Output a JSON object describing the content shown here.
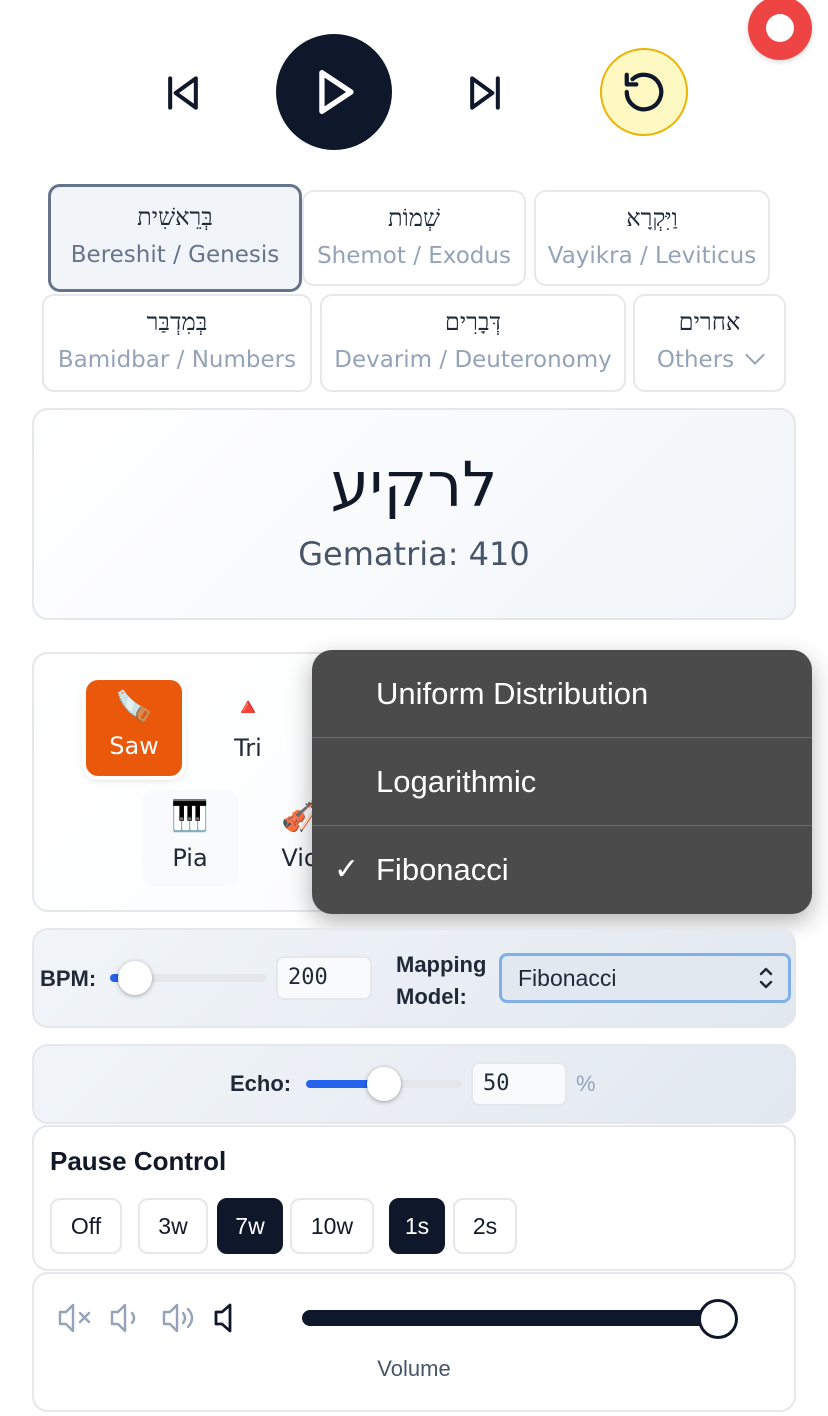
{
  "transport": {
    "record_icon": "record-icon",
    "prev_icon": "skip-back-icon",
    "play_icon": "play-icon",
    "next_icon": "skip-forward-icon",
    "reset_icon": "rotate-ccw-icon"
  },
  "books": [
    {
      "hebrew": "בְּרֵאשִׁית",
      "english": "Bereshit / Genesis",
      "active": true
    },
    {
      "hebrew": "שְׁמוֹת",
      "english": "Shemot / Exodus",
      "active": false
    },
    {
      "hebrew": "וַיִּקְרָא",
      "english": "Vayikra / Leviticus",
      "active": false
    },
    {
      "hebrew": "בְּמִדְבַּר",
      "english": "Bamidbar / Numbers",
      "active": false
    },
    {
      "hebrew": "דְּבָרִים",
      "english": "Devarim / Deuteronomy",
      "active": false
    },
    {
      "hebrew": "אחרים",
      "english": "Others",
      "active": false
    }
  ],
  "word": {
    "text": "לרקיע",
    "gematria": "Gematria: 410"
  },
  "instruments": [
    {
      "icon": "🪚",
      "label": "Saw",
      "active": true
    },
    {
      "icon": "🔺",
      "label": "Tri",
      "active": false
    },
    {
      "icon": "🎹",
      "label": "Pia",
      "active": false
    },
    {
      "icon": "🎻",
      "label": "Vio",
      "active": false
    }
  ],
  "mapping_menu": {
    "options": [
      "Uniform Distribution",
      "Logarithmic",
      "Fibonacci"
    ],
    "selected": "Fibonacci",
    "check": "✓"
  },
  "bpm": {
    "label": "BPM:",
    "value": "200",
    "level": 0.16
  },
  "mapping_model": {
    "label_line1": "Mapping",
    "label_line2": "Model:",
    "value": "Fibonacci"
  },
  "echo": {
    "label": "Echo:",
    "value": "50",
    "unit": "%",
    "level": 0.5
  },
  "pause": {
    "title": "Pause Control",
    "buttons": [
      {
        "label": "Off",
        "on": false
      },
      {
        "label": "3w",
        "on": false
      },
      {
        "label": "7w",
        "on": true
      },
      {
        "label": "10w",
        "on": false
      },
      {
        "label": "1s",
        "on": true
      },
      {
        "label": "2s",
        "on": false
      }
    ]
  },
  "volume": {
    "label": "Volume",
    "level": 1.0,
    "icons": [
      "volume-mute-icon",
      "volume-low-icon",
      "volume-high-icon",
      "volume-icon"
    ]
  },
  "colors": {
    "accent": "#2563eb",
    "primary": "#0f172a",
    "record": "#ef4444",
    "active_instrument": "#ea580c",
    "reset_bg": "#fef9c3"
  }
}
